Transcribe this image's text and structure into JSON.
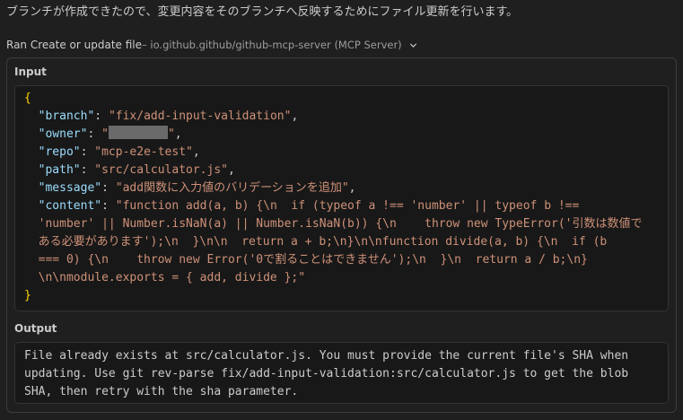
{
  "intro": "ブランチが作成できたので、変更内容をそのブランチへ反映するためにファイル更新を行います。",
  "tool": {
    "action": "Ran Create or update file",
    "server": " – io.github.github/github-mcp-server (MCP Server)",
    "expand_icon": "chevron-down-icon"
  },
  "input_label": "Input",
  "output_label": "Output",
  "params": {
    "open": "{",
    "close": "}",
    "branch_key": "\"branch\"",
    "branch_val": "\"fix/add-input-validation\"",
    "owner_key": "\"owner\"",
    "owner_val_prefix": "\"",
    "owner_val_suffix": "\"",
    "repo_key": "\"repo\"",
    "repo_val": "\"mcp-e2e-test\"",
    "path_key": "\"path\"",
    "path_val": "\"src/calculator.js\"",
    "message_key": "\"message\"",
    "message_val": "\"add関数に入力値のバリデーションを追加\"",
    "content_key": "\"content\""
  },
  "content_lines": [
    "\"function add(a, b) {\\n  if (typeof a !== 'number' || typeof b !==",
    "'number' || Number.isNaN(a) || Number.isNaN(b)) {\\n    throw new TypeError('引数は数値で",
    "ある必要があります');\\n  }\\n\\n  return a + b;\\n}\\n\\nfunction divide(a, b) {\\n  if (b",
    "=== 0) {\\n    throw new Error('0で割ることはできません');\\n  }\\n  return a / b;\\n}",
    "\\n\\nmodule.exports = { add, divide };\""
  ],
  "output_lines": [
    "File already exists at src/calculator.js. You must provide the current file's SHA when",
    "updating. Use git rev-parse fix/add-input-validation:src/calculator.js to get the blob",
    "SHA, then retry with the sha parameter."
  ],
  "colors": {
    "brace": "#ffd700",
    "key": "#9cdcfe",
    "string": "#ce9178",
    "escape": "#d7ba7d"
  }
}
